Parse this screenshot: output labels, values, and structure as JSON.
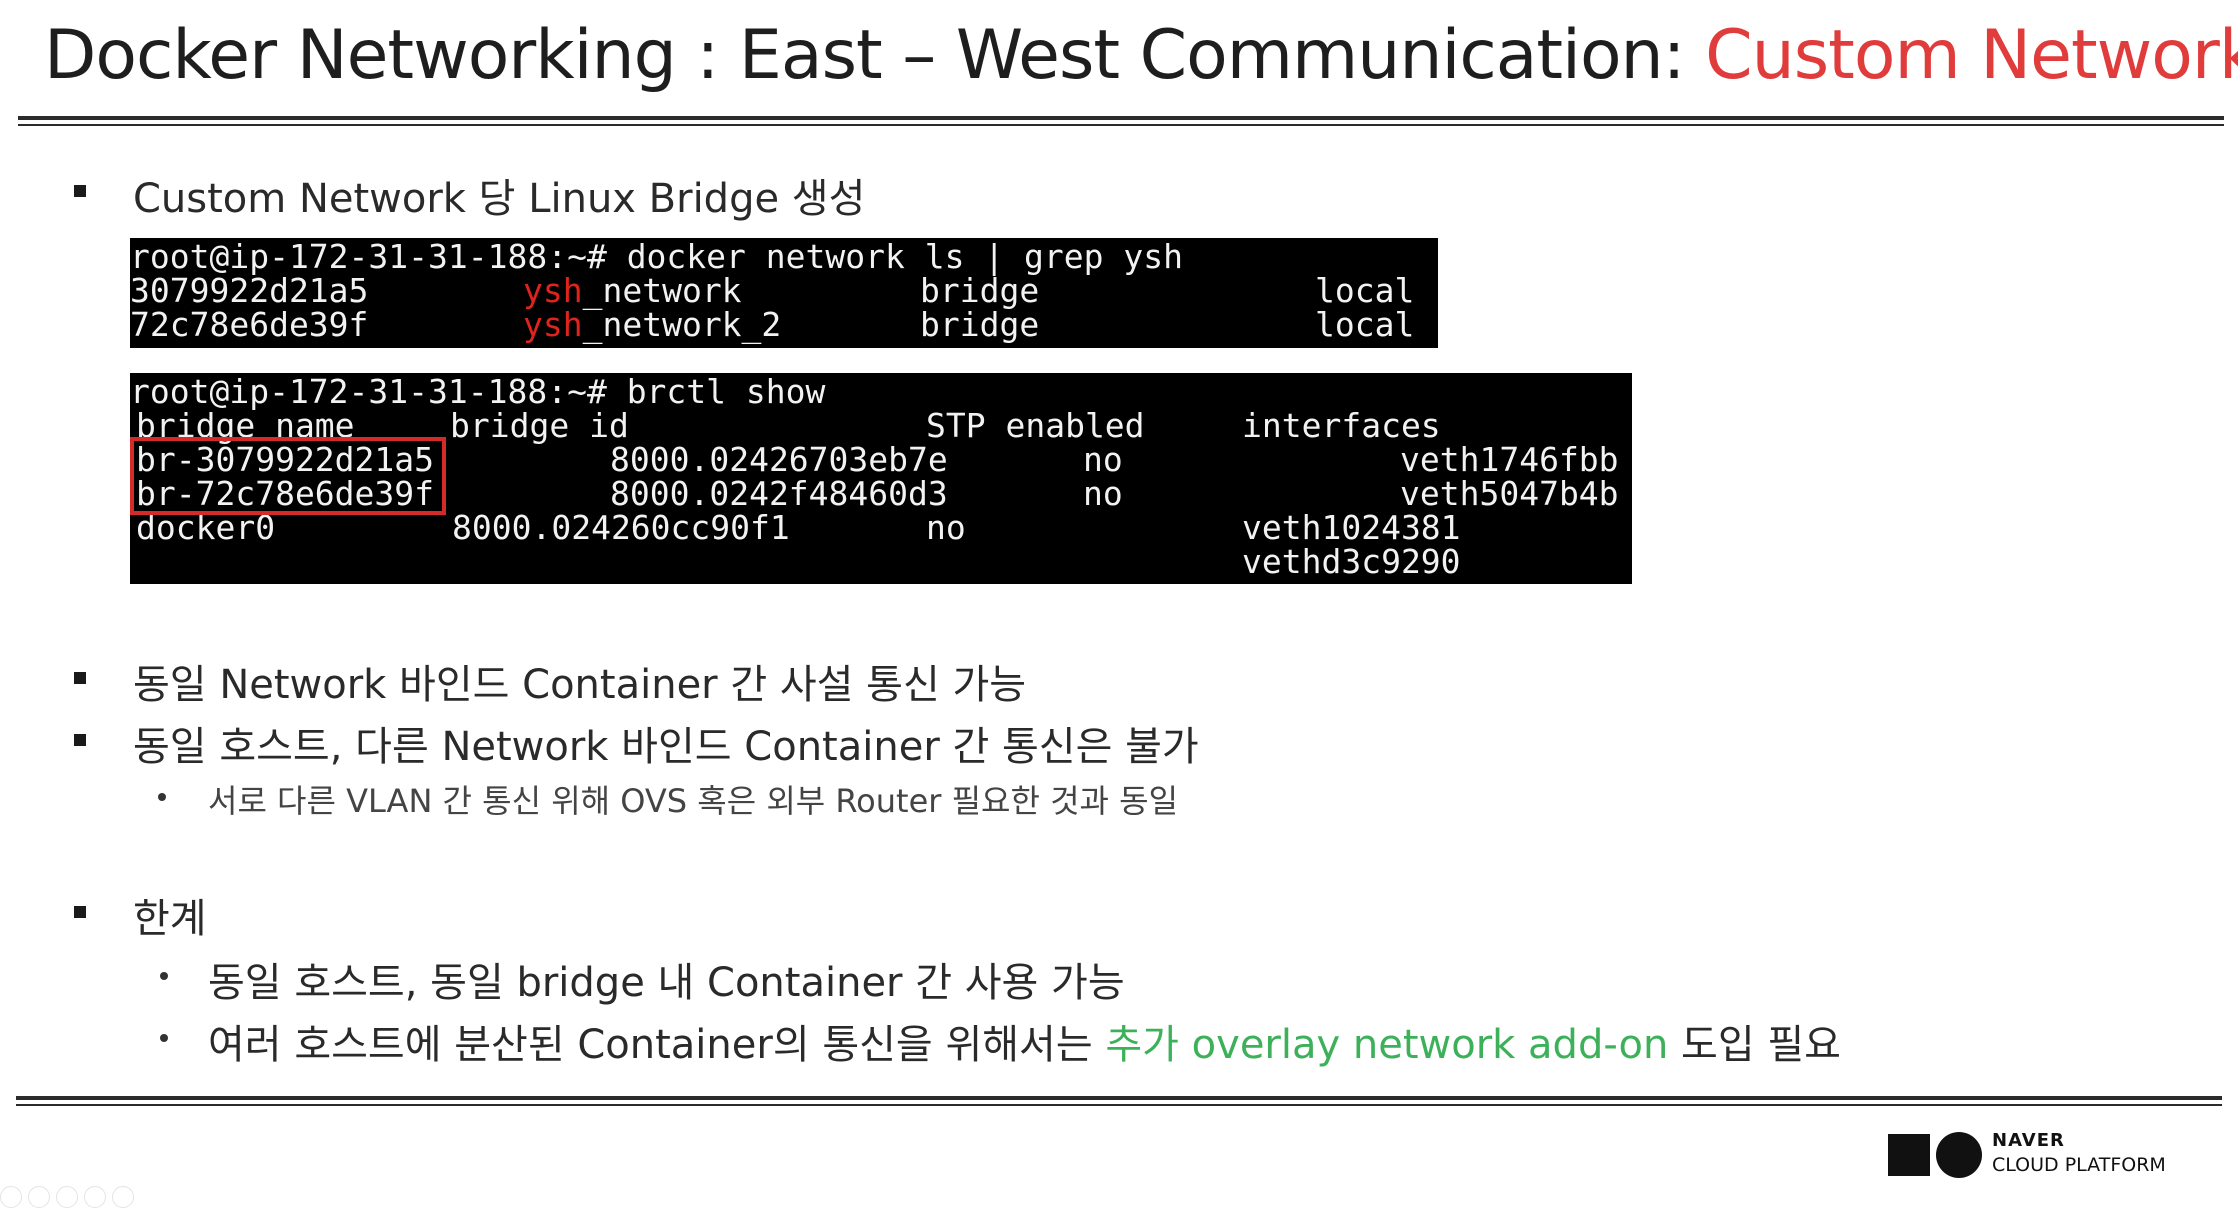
{
  "slide": {
    "title_prefix": "Docker Networking : East – West Communication: ",
    "title_accent": "Custom Network",
    "accent_color": "#e03c3c",
    "highlight_color": "#3cb15a"
  },
  "bullets": {
    "b1": "Custom Network 당 Linux Bridge 생성",
    "b2": "동일 Network 바인드 Container 간 사설 통신 가능",
    "b3": "동일 호스트, 다른 Network 바인드 Container 간 통신은 불가",
    "b3_sub": "서로 다른 VLAN 간 통신 위해 OVS 혹은 외부 Router 필요한 것과 동일",
    "b4": "한계",
    "b4_sub1": "동일 호스트, 동일 bridge 내 Container 간 사용 가능",
    "b4_sub2_pre": "여러 호스트에 분산된 Container의 통신을 위해서는 ",
    "b4_sub2_green": "추가 overlay network add-on",
    "b4_sub2_post": " 도입 필요"
  },
  "terminal1": {
    "prompt": "root@ip-172-31-31-188:~# docker network ls | grep ysh",
    "rows": [
      {
        "id": "3079922d21a5",
        "name_hl": "ysh",
        "name_rest": "_network",
        "driver": "bridge",
        "scope": "local"
      },
      {
        "id": "72c78e6de39f",
        "name_hl": "ysh",
        "name_rest": "_network_2",
        "driver": "bridge",
        "scope": "local"
      }
    ]
  },
  "terminal2": {
    "prompt": "root@ip-172-31-31-188:~# brctl show",
    "headers": {
      "name": "bridge name",
      "id": "bridge id",
      "stp": "STP enabled",
      "ifaces": "interfaces"
    },
    "rows": [
      {
        "name": "br-3079922d21a5",
        "id": "8000.02426703eb7e",
        "stp": "no",
        "iface": "veth1746fbb"
      },
      {
        "name": "br-72c78e6de39f",
        "id": "8000.0242f48460d3",
        "stp": "no",
        "iface": "veth5047b4b"
      },
      {
        "name": "docker0",
        "id": "8000.024260cc90f1",
        "stp": "no",
        "iface": "veth1024381"
      },
      {
        "name": "",
        "id": "",
        "stp": "",
        "iface": "vethd3c9290"
      }
    ]
  },
  "logo": {
    "line1": "NAVER",
    "line2": "CLOUD PLATFORM"
  }
}
